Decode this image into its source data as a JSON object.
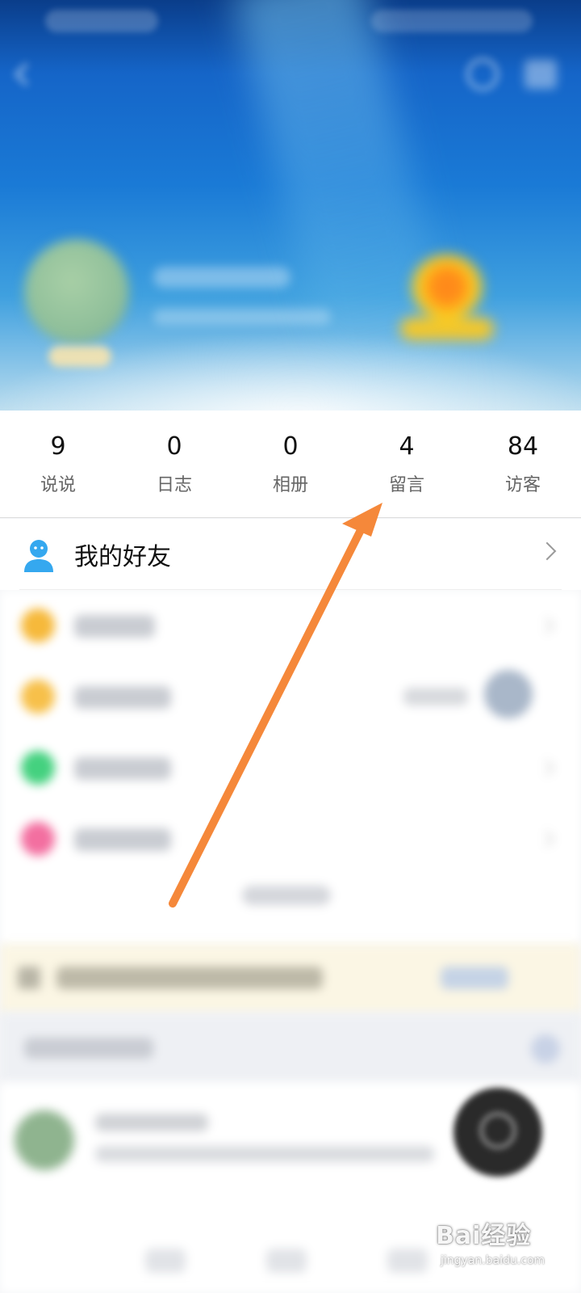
{
  "stats": [
    {
      "value": "9",
      "label": "说说"
    },
    {
      "value": "0",
      "label": "日志"
    },
    {
      "value": "0",
      "label": "相册"
    },
    {
      "value": "4",
      "label": "留言"
    },
    {
      "value": "84",
      "label": "访客"
    }
  ],
  "friends": {
    "label": "我的好友",
    "icon": "person-icon"
  },
  "blurred_rows": [
    {
      "icon_color": "#f6b93b"
    },
    {
      "icon_color": "#f7c04a"
    },
    {
      "icon_color": "#44d17f"
    },
    {
      "icon_color": "#f36fa0"
    }
  ],
  "annotation": {
    "color": "#f5883a",
    "points_to": "留言"
  },
  "watermark": {
    "logo": "Bai经验",
    "sub": "jingyan.baidu.com"
  },
  "colors": {
    "accent": "#35a8ef",
    "banner_top": "#0a3d8a",
    "banner_mid": "#1a7ad6"
  }
}
